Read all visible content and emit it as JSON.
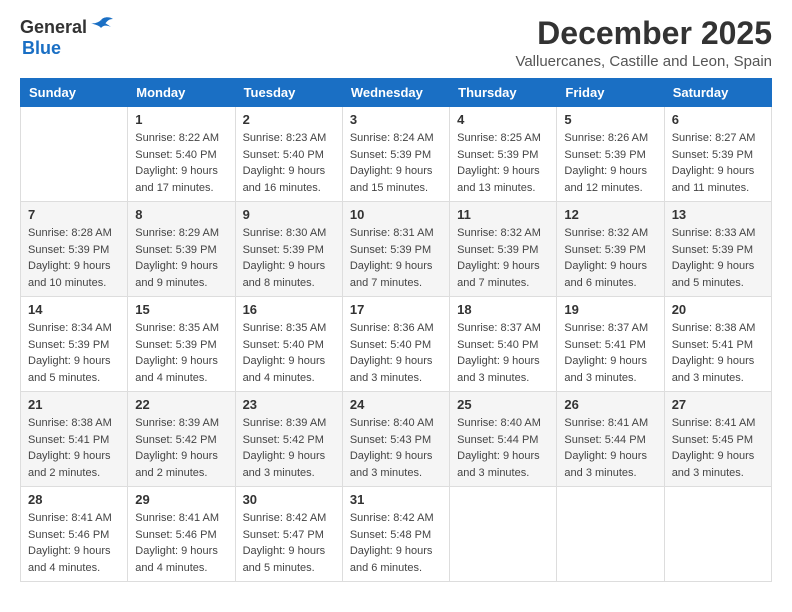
{
  "logo": {
    "general": "General",
    "blue": "Blue"
  },
  "title": "December 2025",
  "location": "Valluercanes, Castille and Leon, Spain",
  "days_of_week": [
    "Sunday",
    "Monday",
    "Tuesday",
    "Wednesday",
    "Thursday",
    "Friday",
    "Saturday"
  ],
  "weeks": [
    [
      {
        "day": "",
        "info": ""
      },
      {
        "day": "1",
        "info": "Sunrise: 8:22 AM\nSunset: 5:40 PM\nDaylight: 9 hours\nand 17 minutes."
      },
      {
        "day": "2",
        "info": "Sunrise: 8:23 AM\nSunset: 5:40 PM\nDaylight: 9 hours\nand 16 minutes."
      },
      {
        "day": "3",
        "info": "Sunrise: 8:24 AM\nSunset: 5:39 PM\nDaylight: 9 hours\nand 15 minutes."
      },
      {
        "day": "4",
        "info": "Sunrise: 8:25 AM\nSunset: 5:39 PM\nDaylight: 9 hours\nand 13 minutes."
      },
      {
        "day": "5",
        "info": "Sunrise: 8:26 AM\nSunset: 5:39 PM\nDaylight: 9 hours\nand 12 minutes."
      },
      {
        "day": "6",
        "info": "Sunrise: 8:27 AM\nSunset: 5:39 PM\nDaylight: 9 hours\nand 11 minutes."
      }
    ],
    [
      {
        "day": "7",
        "info": "Sunrise: 8:28 AM\nSunset: 5:39 PM\nDaylight: 9 hours\nand 10 minutes."
      },
      {
        "day": "8",
        "info": "Sunrise: 8:29 AM\nSunset: 5:39 PM\nDaylight: 9 hours\nand 9 minutes."
      },
      {
        "day": "9",
        "info": "Sunrise: 8:30 AM\nSunset: 5:39 PM\nDaylight: 9 hours\nand 8 minutes."
      },
      {
        "day": "10",
        "info": "Sunrise: 8:31 AM\nSunset: 5:39 PM\nDaylight: 9 hours\nand 7 minutes."
      },
      {
        "day": "11",
        "info": "Sunrise: 8:32 AM\nSunset: 5:39 PM\nDaylight: 9 hours\nand 7 minutes."
      },
      {
        "day": "12",
        "info": "Sunrise: 8:32 AM\nSunset: 5:39 PM\nDaylight: 9 hours\nand 6 minutes."
      },
      {
        "day": "13",
        "info": "Sunrise: 8:33 AM\nSunset: 5:39 PM\nDaylight: 9 hours\nand 5 minutes."
      }
    ],
    [
      {
        "day": "14",
        "info": "Sunrise: 8:34 AM\nSunset: 5:39 PM\nDaylight: 9 hours\nand 5 minutes."
      },
      {
        "day": "15",
        "info": "Sunrise: 8:35 AM\nSunset: 5:39 PM\nDaylight: 9 hours\nand 4 minutes."
      },
      {
        "day": "16",
        "info": "Sunrise: 8:35 AM\nSunset: 5:40 PM\nDaylight: 9 hours\nand 4 minutes."
      },
      {
        "day": "17",
        "info": "Sunrise: 8:36 AM\nSunset: 5:40 PM\nDaylight: 9 hours\nand 3 minutes."
      },
      {
        "day": "18",
        "info": "Sunrise: 8:37 AM\nSunset: 5:40 PM\nDaylight: 9 hours\nand 3 minutes."
      },
      {
        "day": "19",
        "info": "Sunrise: 8:37 AM\nSunset: 5:41 PM\nDaylight: 9 hours\nand 3 minutes."
      },
      {
        "day": "20",
        "info": "Sunrise: 8:38 AM\nSunset: 5:41 PM\nDaylight: 9 hours\nand 3 minutes."
      }
    ],
    [
      {
        "day": "21",
        "info": "Sunrise: 8:38 AM\nSunset: 5:41 PM\nDaylight: 9 hours\nand 2 minutes."
      },
      {
        "day": "22",
        "info": "Sunrise: 8:39 AM\nSunset: 5:42 PM\nDaylight: 9 hours\nand 2 minutes."
      },
      {
        "day": "23",
        "info": "Sunrise: 8:39 AM\nSunset: 5:42 PM\nDaylight: 9 hours\nand 3 minutes."
      },
      {
        "day": "24",
        "info": "Sunrise: 8:40 AM\nSunset: 5:43 PM\nDaylight: 9 hours\nand 3 minutes."
      },
      {
        "day": "25",
        "info": "Sunrise: 8:40 AM\nSunset: 5:44 PM\nDaylight: 9 hours\nand 3 minutes."
      },
      {
        "day": "26",
        "info": "Sunrise: 8:41 AM\nSunset: 5:44 PM\nDaylight: 9 hours\nand 3 minutes."
      },
      {
        "day": "27",
        "info": "Sunrise: 8:41 AM\nSunset: 5:45 PM\nDaylight: 9 hours\nand 3 minutes."
      }
    ],
    [
      {
        "day": "28",
        "info": "Sunrise: 8:41 AM\nSunset: 5:46 PM\nDaylight: 9 hours\nand 4 minutes."
      },
      {
        "day": "29",
        "info": "Sunrise: 8:41 AM\nSunset: 5:46 PM\nDaylight: 9 hours\nand 4 minutes."
      },
      {
        "day": "30",
        "info": "Sunrise: 8:42 AM\nSunset: 5:47 PM\nDaylight: 9 hours\nand 5 minutes."
      },
      {
        "day": "31",
        "info": "Sunrise: 8:42 AM\nSunset: 5:48 PM\nDaylight: 9 hours\nand 6 minutes."
      },
      {
        "day": "",
        "info": ""
      },
      {
        "day": "",
        "info": ""
      },
      {
        "day": "",
        "info": ""
      }
    ]
  ]
}
